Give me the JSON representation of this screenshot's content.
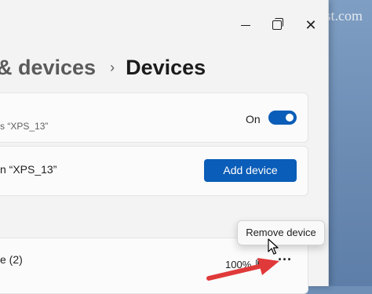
{
  "watermark": "groovyPost.com",
  "titlebar": {
    "icons": [
      "minimize-icon",
      "maximize-icon",
      "close-icon"
    ],
    "close_glyph": "✕"
  },
  "breadcrumb": {
    "parent": "& devices",
    "separator": "›",
    "current": "Devices"
  },
  "cards": {
    "discoverable": {
      "text": "s “XPS_13”",
      "toggle_label": "On",
      "toggle_on": true
    },
    "add_device": {
      "text": "n “XPS_13”",
      "button_label": "Add device"
    },
    "paired_device": {
      "name": "e (2)",
      "battery": "100%",
      "more_glyph": "···"
    }
  },
  "context_menu": {
    "items": [
      "Remove device"
    ]
  },
  "colors": {
    "accent": "#0a5db8",
    "annotation_arrow": "#e0393a"
  }
}
